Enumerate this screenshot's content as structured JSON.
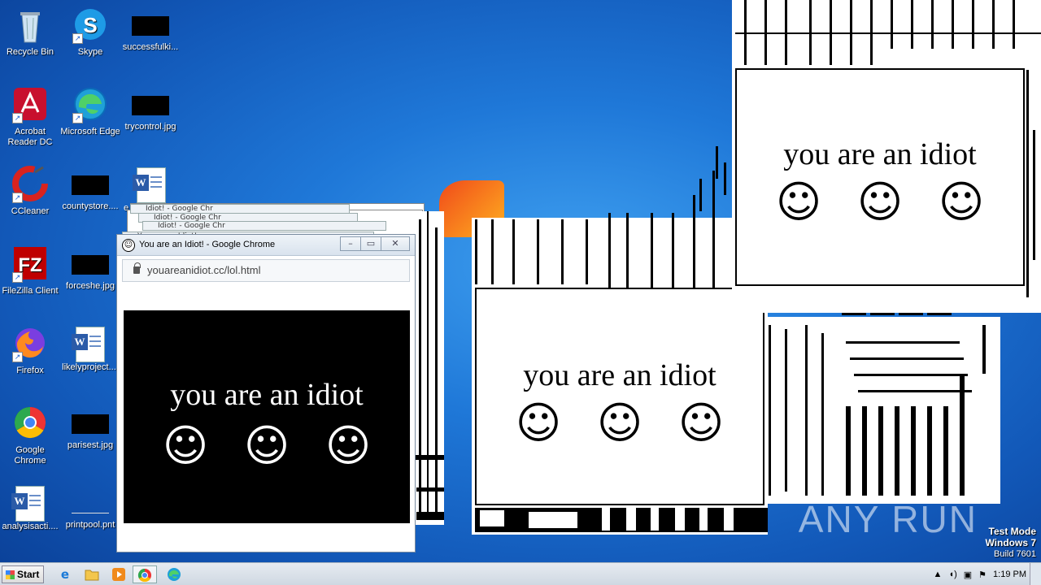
{
  "desktop_icons": [
    {
      "label": "Recycle Bin"
    },
    {
      "label": "Skype"
    },
    {
      "label": "successfulki..."
    },
    {
      "label": "Acrobat Reader DC"
    },
    {
      "label": "Microsoft Edge"
    },
    {
      "label": "trycontrol.jpg"
    },
    {
      "label": "CCleaner"
    },
    {
      "label": "countystore...."
    },
    {
      "label": "e"
    },
    {
      "label": "FileZilla Client"
    },
    {
      "label": "forceshe.jpg"
    },
    {
      "label": "Firefox"
    },
    {
      "label": "likelyproject...."
    },
    {
      "label": "Google Chrome"
    },
    {
      "label": "parisest.jpg"
    },
    {
      "label": "analysisacti...."
    },
    {
      "label": "printpool.pnt"
    }
  ],
  "chrome_window": {
    "title": "You are an Idiot! - Google Chrome",
    "url": "youareanidiot.cc/lol.html",
    "message": "you are an idiot",
    "faces": [
      "☺",
      "☺",
      "☺"
    ]
  },
  "ghost_tabs": [
    "Idiot! - Google Chr",
    "Idiot! - Google Chr",
    "Idiot! - Google Chr",
    "You are an Idiot!"
  ],
  "white_popup_1": {
    "message": "you are an idiot",
    "faces": [
      "☺",
      "☺",
      "☺"
    ]
  },
  "white_popup_2": {
    "message": "you are an idiot",
    "faces": [
      "☺",
      "☺",
      "☺"
    ]
  },
  "watermark": "ANY RUN",
  "test_mode": {
    "line1": "Test Mode",
    "line2": "Windows 7",
    "line3": "Build 7601"
  },
  "taskbar": {
    "start_label": "Start",
    "pinned": [
      "ie-icon",
      "explorer-icon",
      "media-player-icon",
      "chrome-icon",
      "edge-icon"
    ],
    "clock": "1:19 PM"
  }
}
